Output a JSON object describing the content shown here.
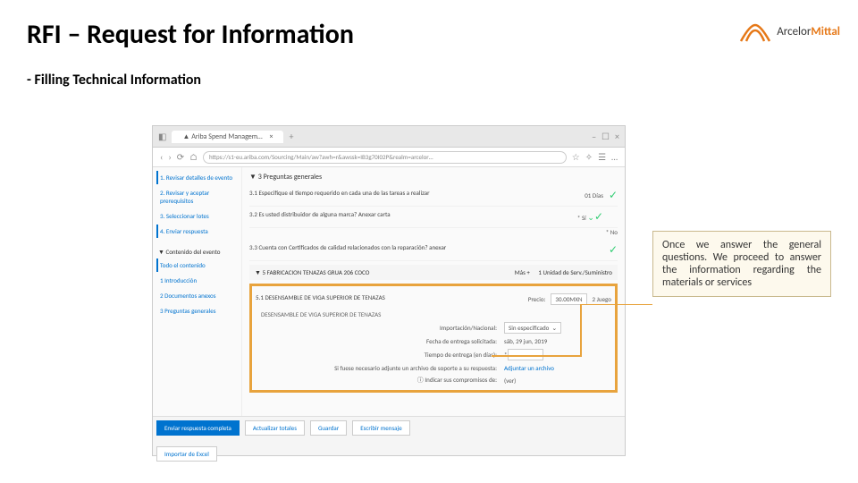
{
  "slide": {
    "title": "RFI – Request for Information",
    "subtitle": "- Filling Technical Information"
  },
  "logo": {
    "name": "ArcelorMittal",
    "part1": "Arcelor",
    "part2": "Mittal"
  },
  "browser": {
    "tab_title": "Ariba Spend Managem…",
    "tab_close": "×",
    "tab_plus": "+",
    "url": "https://s1-eu.ariba.com/Sourcing/Main/aw?awh=r&awssk=IB3g70I02P&realm=arcelor…",
    "nav": {
      "back": "‹",
      "forward": "›",
      "refresh": "⟳",
      "home": "⌂"
    },
    "icons": {
      "star": "☆",
      "bookmark": "✧",
      "reader": "☰",
      "more": "…"
    }
  },
  "sidebar": {
    "items": [
      {
        "num": "1.",
        "label": "Revisar detalles de evento"
      },
      {
        "num": "2.",
        "label": "Revisar y aceptar prerequisitos"
      },
      {
        "num": "3.",
        "label": "Seleccionar lotes"
      },
      {
        "num": "4.",
        "label": "Enviar respuesta"
      }
    ],
    "content_head": "▼ Contenido del evento",
    "content_items": [
      {
        "label": "Todo el contenido"
      },
      {
        "num": "1",
        "label": "Introducción"
      },
      {
        "num": "2",
        "label": "Documentos anexos"
      },
      {
        "num": "3",
        "label": "Preguntas generales"
      }
    ]
  },
  "main": {
    "section3": "▼ 3 Preguntas generales",
    "q31": {
      "text": "3.1 Especifique el tiempo requerido en cada una de las tareas a realizar",
      "answer": "01 Días"
    },
    "q32": {
      "text": "3.2 Es usted distribuidor de alguna marca? Anexar carta",
      "answer_yes": "Sí",
      "answer_no": "No"
    },
    "q33": {
      "text": "3.3 Cuenta con Certificados de calidad relacionados con la reparación? anexar"
    },
    "section5": "▼ 5 FABRICACION TENAZAS GRUA 206 COCO",
    "section5_right1": "Más +",
    "section5_right2": "1 Unidad de Serv./Suministro",
    "item51": {
      "text": "5.1 DESENSAMBLE DE VIGA SUPERIOR DE TENAZAS",
      "price_label": "Precio:",
      "price_val": "30.00MXN",
      "qty": "2 Juego"
    },
    "item_desc": "DESENSAMBLE DE VIGA SUPERIOR DE TENAZAS",
    "form": {
      "row1_label": "Importación/Nacional:",
      "row1_val": "Sin especificado",
      "row2_label": "Fecha de entrega solicitada:",
      "row2_val": "sáb, 29 jun, 2019",
      "row3_label": "Tiempo de entrega (en días):",
      "row4_label": "Si fuese necesario adjunte un archivo de soporte a su respuesta:",
      "row4_val": "Adjuntar un archivo",
      "row5_label": "Indicar sus compromisos de:",
      "row5_val": "(ver)"
    }
  },
  "actions": {
    "submit": "Enviar respuesta completa",
    "update": "Actualizar totales",
    "save": "Guardar",
    "compose": "Escribir mensaje",
    "import": "Importar de Excel"
  },
  "callout": {
    "text": "Once we answer the general questions. We proceed to answer the information regarding the materials or services"
  }
}
